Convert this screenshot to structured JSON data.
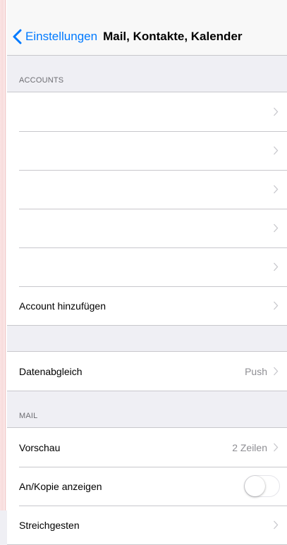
{
  "nav": {
    "back_label": "Einstellungen",
    "title": "Mail, Kontakte, Kalender"
  },
  "accounts_section": {
    "header": "ACCOUNTS",
    "add_account_label": "Account hinzufügen"
  },
  "sync_section": {
    "label": "Datenabgleich",
    "value": "Push"
  },
  "mail_section": {
    "header": "MAIL",
    "preview_label": "Vorschau",
    "preview_value": "2 Zeilen",
    "cc_label": "An/Kopie anzeigen",
    "cc_enabled": false,
    "swipe_label": "Streichgesten"
  },
  "colors": {
    "accent": "#007aff",
    "background": "#efeff4",
    "separator": "#c8c7cc",
    "secondary_text": "#8e8e93"
  },
  "icons": {
    "back": "chevron-left-icon",
    "disclosure": "chevron-right-icon"
  }
}
